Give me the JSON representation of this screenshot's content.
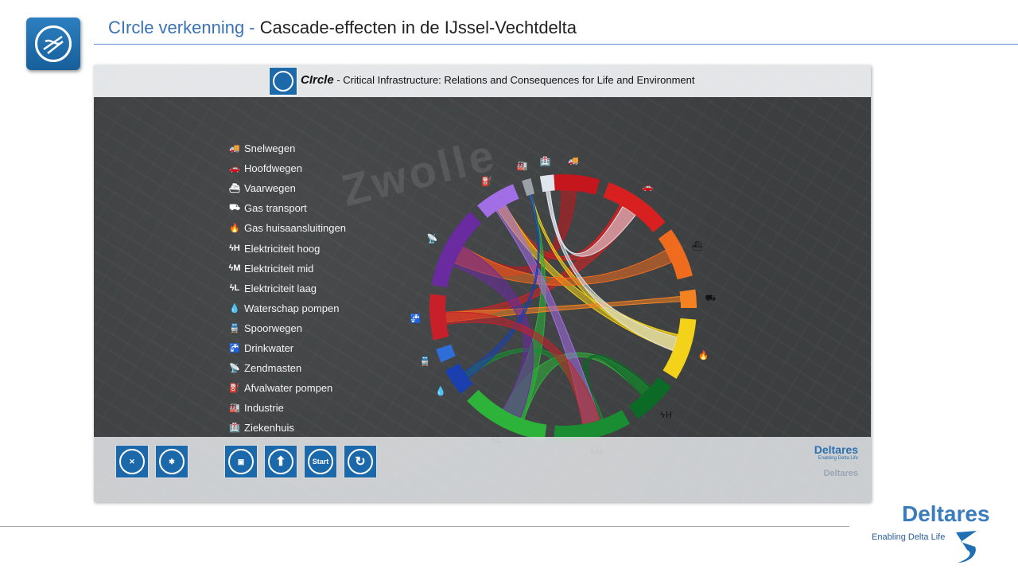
{
  "slide": {
    "title_prefix": "CIrcle verkenning - ",
    "title_main": "Cascade-effecten in de IJssel-Vechtdelta"
  },
  "app": {
    "brand": "CIrcle",
    "subtitle": " - Critical Infrastructure: Relations and Consequences for Life and Environment",
    "map_label": "Zwolle"
  },
  "legend": [
    {
      "icon": "truck-icon",
      "glyph": "🚚",
      "label": "Snelwegen"
    },
    {
      "icon": "car-icon",
      "glyph": "🚗",
      "label": "Hoofdwegen"
    },
    {
      "icon": "ship-icon",
      "glyph": "⛴",
      "label": "Vaarwegen"
    },
    {
      "icon": "gas-truck-icon",
      "glyph": "⛟",
      "label": "Gas transport"
    },
    {
      "icon": "flame-icon",
      "glyph": "🔥",
      "label": "Gas huisaansluitingen"
    },
    {
      "icon": "power-high-icon",
      "glyph": "ϟH",
      "label": "Elektriciteit hoog"
    },
    {
      "icon": "power-mid-icon",
      "glyph": "ϟM",
      "label": "Elektriciteit mid"
    },
    {
      "icon": "power-low-icon",
      "glyph": "ϟL",
      "label": "Elektriciteit laag"
    },
    {
      "icon": "water-drop-icon",
      "glyph": "💧",
      "label": "Waterschap pompen"
    },
    {
      "icon": "train-icon",
      "glyph": "🚆",
      "label": "Spoorwegen"
    },
    {
      "icon": "faucet-icon",
      "glyph": "🚰",
      "label": "Drinkwater"
    },
    {
      "icon": "antenna-icon",
      "glyph": "📡",
      "label": "Zendmasten"
    },
    {
      "icon": "pump-icon",
      "glyph": "⛽",
      "label": "Afvalwater pompen"
    },
    {
      "icon": "factory-icon",
      "glyph": "🏭",
      "label": "Industrie"
    },
    {
      "icon": "hospital-icon",
      "glyph": "🏥",
      "label": "Ziekenhuis"
    }
  ],
  "chord_arcs": [
    {
      "name": "Snelwegen",
      "color": "#c4161c",
      "start": -8,
      "end": 16
    },
    {
      "name": "Hoofdwegen",
      "color": "#d92020",
      "start": 20,
      "end": 50
    },
    {
      "name": "Vaarwegen",
      "color": "#ef6c1e",
      "start": 54,
      "end": 76
    },
    {
      "name": "Gas transport",
      "color": "#f58220",
      "start": 82,
      "end": 90
    },
    {
      "name": "Gas huisaansluitingen",
      "color": "#f4d21a",
      "start": 95,
      "end": 122
    },
    {
      "name": "Elektriciteit hoog",
      "color": "#0b6a25",
      "start": 126,
      "end": 146
    },
    {
      "name": "Elektriciteit mid",
      "color": "#1a8d32",
      "start": 150,
      "end": 184
    },
    {
      "name": "Elektriciteit laag",
      "color": "#2db23a",
      "start": 188,
      "end": 226
    },
    {
      "name": "Waterschap pompen",
      "color": "#1b3fae",
      "start": 230,
      "end": 242
    },
    {
      "name": "Spoorwegen",
      "color": "#2f6ed8",
      "start": 246,
      "end": 252
    },
    {
      "name": "Drinkwater",
      "color": "#c8202a",
      "start": 256,
      "end": 276
    },
    {
      "name": "Zendmasten",
      "color": "#6a2aa0",
      "start": 280,
      "end": 316
    },
    {
      "name": "Afvalwater pompen",
      "color": "#a26ee6",
      "start": 320,
      "end": 338
    },
    {
      "name": "Industrie",
      "color": "#9aa2a8",
      "start": 342,
      "end": 346
    },
    {
      "name": "Ziekenhuis",
      "color": "#dfe6ee",
      "start": 350,
      "end": 356
    }
  ],
  "toolbar": {
    "buttons": [
      {
        "name": "map-toggle-button",
        "label": ""
      },
      {
        "name": "circle-view-button",
        "label": ""
      },
      {
        "name": "save-button",
        "label": ""
      },
      {
        "name": "upload-button",
        "label": ""
      },
      {
        "name": "start-button",
        "label": "Start"
      },
      {
        "name": "reset-button",
        "label": ""
      }
    ],
    "brand": "Deltares",
    "tagline": "Enabling Delta Life",
    "ghost": "Deltares"
  },
  "footer": {
    "brand": "Deltares",
    "tagline": "Enabling Delta Life"
  },
  "colors": {
    "title_prefix": "#3a72b4",
    "accent": "#1b69aa",
    "deltares": "#3a7cbc"
  }
}
